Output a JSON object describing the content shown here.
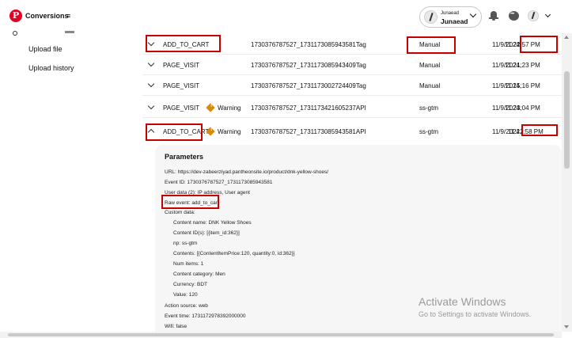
{
  "app": {
    "title": "Conversions",
    "menu_icon": "≡",
    "logo_letter": "P"
  },
  "account": {
    "small": "Junaead",
    "name": "Junaead"
  },
  "icons": [
    "pinterest-logo-icon",
    "hamburger-menu-icon",
    "chevron-down-icon",
    "bell-icon",
    "chat-icon",
    "avatar-icon",
    "warning-icon"
  ],
  "sidebar": {
    "items": [
      {
        "label": "Upload file"
      },
      {
        "label": "Upload history"
      }
    ]
  },
  "rows": [
    {
      "event": "ADD_TO_CART",
      "warning": "",
      "id": "1730376787527_1731173085943581Tag",
      "source": "Manual",
      "date": "11/9/2024,",
      "time": "11:22:57 PM",
      "expanded": false
    },
    {
      "event": "PAGE_VISIT",
      "warning": "",
      "id": "1730376787527_1731173085943409Tag",
      "source": "Manual",
      "date": "11/9/2024,",
      "time": "11:21:23 PM",
      "expanded": false
    },
    {
      "event": "PAGE_VISIT",
      "warning": "",
      "id": "1730376787527_1731173002724409Tag",
      "source": "Manual",
      "date": "11/9/2024,",
      "time": "11:15:16 PM",
      "expanded": false
    },
    {
      "event": "PAGE_VISIT",
      "warning": "Warning",
      "id": "1730376787527_1731173421605237API",
      "source": "ss-gtm",
      "date": "11/9/2024,",
      "time": "11:23:04 PM",
      "expanded": false
    },
    {
      "event": "ADD_TO_CART",
      "warning": "Warning",
      "id": "1730376787527_1731173085943581API",
      "source": "ss-gtm",
      "date": "11/9/2024,",
      "time": "11:22:58 PM",
      "expanded": true
    }
  ],
  "parameters": {
    "title": "Parameters",
    "lines": [
      "URL: https://dev-zabeerziyad.pantheonsite.io/product/dnk-yellow-shoes/",
      "Event ID: 1730376787527_1731173085943581",
      "User data (2): IP address, User agent",
      "Raw event: add_to_cart",
      "Custom data:",
      "Content name: DNK Yellow Shoes",
      "Content ID(s): [{item_id:362}]",
      "np: ss-gtm",
      "Contents: [{ContentItemPrice:120, quantity:0, id:362}]",
      "Num items: 1",
      "Content category: Men",
      "Currency: BDT",
      "Value: 120",
      "Action source: web",
      "Event time: 1731172978392000000",
      "Wifi: false"
    ]
  },
  "watermark": {
    "title": "Activate Windows",
    "subtitle": "Go to Settings to activate Windows."
  }
}
